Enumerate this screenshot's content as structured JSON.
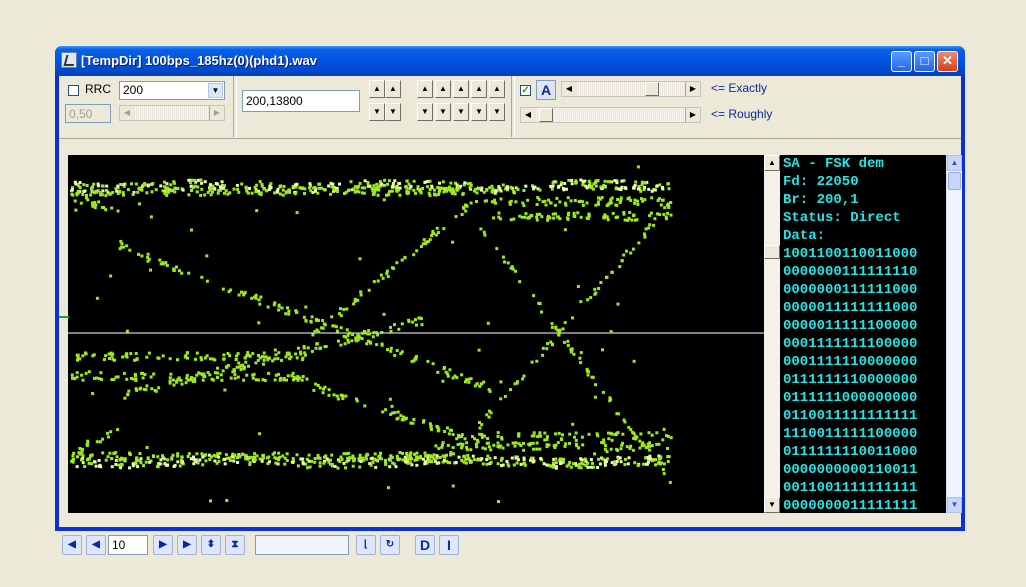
{
  "window": {
    "title": "[TempDir] 100bps_185hz(0)(phd1).wav",
    "minimize": "_",
    "maximize": "□",
    "close": "✕"
  },
  "toolbar": {
    "rrc_label": "RRC",
    "rrc_checked": false,
    "rrc_value": "200",
    "rolloff_value": "0,50",
    "freq_value": "200,13800",
    "auto_label": "A",
    "auto_checked": true,
    "exactly_label": "<= Exactly",
    "roughly_label": "<= Roughly",
    "exactly_slider_level": 0.72,
    "roughly_slider_level": 0.03
  },
  "terminal": {
    "lines": [
      "SA - FSK dem",
      "Fd: 22050",
      "Br: 200,1",
      "Status: Direct",
      "Data:",
      "1001100110011000",
      "0000000111111110",
      "0000000111111000",
      "0000011111111000",
      "0000011111100000",
      "0001111111100000",
      "0001111110000000",
      "0111111110000000",
      "0111111000000000",
      "0110011111111111",
      "1110011111100000",
      "0111111110011000",
      "0000000000110011",
      "0011001111111111",
      "0000000011111111"
    ]
  },
  "bottombar": {
    "step_value": "10",
    "info_value": "",
    "d_label": "D",
    "i_label": "I"
  },
  "colors": {
    "trace": "#9ee81e",
    "trace_bright": "#e8ffb0",
    "centerline": "#ffffff",
    "terminal_text": "#27e3e3"
  }
}
